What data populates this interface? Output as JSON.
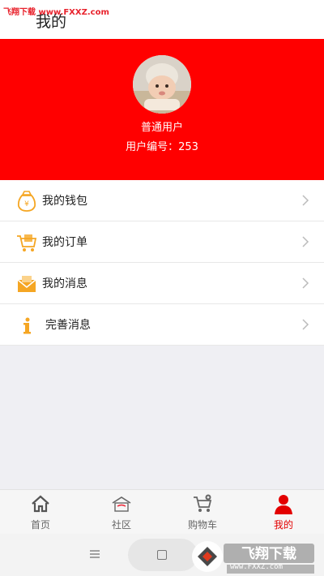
{
  "watermark": {
    "top_text": "飞翔下载 www.FXXZ.com",
    "logo_text": "飞翔下载",
    "logo_url": "www.FXXZ.com"
  },
  "header": {
    "title": "我的"
  },
  "profile": {
    "username": "普通用户",
    "user_id_text": "用户编号：253"
  },
  "menu": {
    "items": [
      {
        "label": "我的钱包",
        "icon": "wallet-icon"
      },
      {
        "label": "我的订单",
        "icon": "cart-order-icon"
      },
      {
        "label": "我的消息",
        "icon": "mail-icon"
      },
      {
        "label": "完善消息",
        "icon": "info-icon"
      }
    ]
  },
  "nav": {
    "items": [
      {
        "label": "首页",
        "icon": "home-icon"
      },
      {
        "label": "社区",
        "icon": "community-icon"
      },
      {
        "label": "购物车",
        "icon": "shopping-cart-icon"
      },
      {
        "label": "我的",
        "icon": "user-icon",
        "active": true
      }
    ]
  },
  "colors": {
    "accent": "#ff0000",
    "icon_gold": "#f5a623",
    "active_nav": "#e30000"
  }
}
